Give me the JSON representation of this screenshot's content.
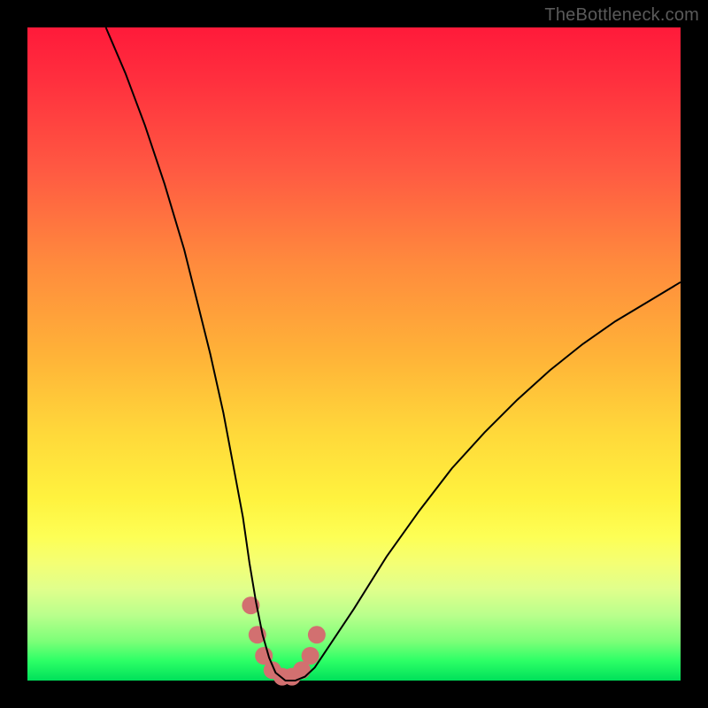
{
  "watermark": {
    "text": "TheBottleneck.com"
  },
  "chart_data": {
    "type": "line",
    "title": "",
    "xlabel": "",
    "ylabel": "",
    "xlim": [
      0,
      100
    ],
    "ylim": [
      0,
      100
    ],
    "grid": false,
    "legend": false,
    "series": [
      {
        "name": "bottleneck-curve",
        "stroke": "#000000",
        "stroke_width": 2,
        "x": [
          12,
          15,
          18,
          21,
          24,
          26,
          28,
          30,
          31.5,
          33,
          34,
          35,
          36,
          37,
          38,
          39.5,
          41,
          42.5,
          44,
          46,
          50,
          55,
          60,
          65,
          70,
          75,
          80,
          85,
          90,
          95,
          100
        ],
        "y": [
          100,
          93,
          85,
          76,
          66,
          58,
          50,
          41,
          33,
          25,
          18,
          12,
          7,
          3.5,
          1.2,
          0,
          0,
          0.6,
          2,
          5,
          11,
          19,
          26,
          32.5,
          38,
          43,
          47.5,
          51.5,
          55,
          58,
          61
        ]
      },
      {
        "name": "highlight-dots",
        "stroke": "#d27070",
        "marker_radius": 10,
        "x": [
          34.2,
          35.2,
          36.2,
          37.5,
          39.0,
          40.5,
          42.0,
          43.3,
          44.3
        ],
        "y": [
          11.5,
          7.0,
          3.8,
          1.6,
          0.6,
          0.6,
          1.6,
          3.8,
          7.0
        ]
      }
    ]
  }
}
